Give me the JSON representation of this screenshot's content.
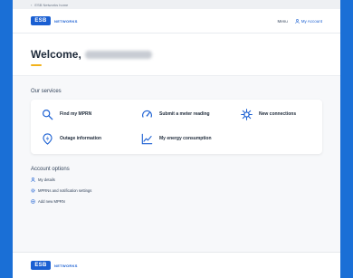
{
  "top_strip": {
    "back_label": "ESB Networks home"
  },
  "header": {
    "logo_mark": "ESB",
    "logo_text": "NETWORKS",
    "nav_link": "Menu",
    "account_label": "My Account"
  },
  "welcome": {
    "greeting": "Welcome,"
  },
  "services": {
    "title": "Our services",
    "items": [
      {
        "label": "Find my MPRN",
        "icon": "search-icon"
      },
      {
        "label": "Submit a meter reading",
        "icon": "meter-icon"
      },
      {
        "label": "New connections",
        "icon": "connections-icon"
      },
      {
        "label": "Outage information",
        "icon": "outage-icon"
      },
      {
        "label": "My energy consumption",
        "icon": "energy-chart-icon"
      }
    ]
  },
  "account_options": {
    "title": "Account options",
    "items": [
      {
        "label": "My details",
        "icon": "user-icon"
      },
      {
        "label": "MPRNs and notification settings",
        "icon": "settings-icon"
      },
      {
        "label": "Add new MPRN",
        "icon": "add-icon"
      }
    ]
  },
  "footer": {
    "logo_mark": "ESB",
    "logo_text": "NETWORKS"
  },
  "colors": {
    "brand_blue": "#1a5fd2",
    "accent_yellow": "#f2b21b",
    "backdrop": "#1a6fd6"
  }
}
